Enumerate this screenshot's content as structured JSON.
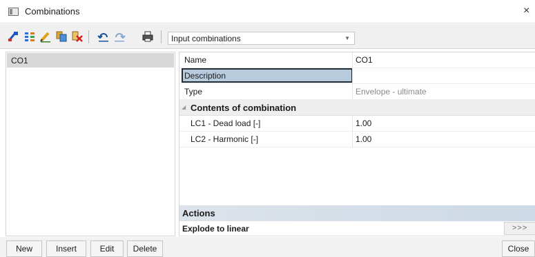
{
  "window": {
    "title": "Combinations",
    "close_glyph": "×"
  },
  "toolbar": {
    "icons": [
      "new-combination-icon",
      "generate-icon",
      "edit-icon",
      "copy-icon",
      "delete-icon",
      "undo-icon",
      "redo-icon",
      "print-icon"
    ],
    "combo_value": "Input combinations"
  },
  "list": {
    "items": [
      "CO1"
    ]
  },
  "properties": {
    "rows": [
      {
        "label": "Name",
        "value": "CO1"
      },
      {
        "label": "Description",
        "value": ""
      },
      {
        "label": "Type",
        "value": "Envelope - ultimate"
      }
    ],
    "section_title": "Contents of combination",
    "contents": [
      {
        "label": "LC1 - Dead load [-]",
        "value": "1.00"
      },
      {
        "label": "LC2 - Harmonic [-]",
        "value": "1.00"
      }
    ]
  },
  "actions": {
    "header": "Actions",
    "items": [
      {
        "label": "Explode to linear",
        "button": ">>>"
      }
    ]
  },
  "buttons": {
    "new": "New",
    "insert": "Insert",
    "edit": "Edit",
    "delete": "Delete",
    "close": "Close"
  }
}
